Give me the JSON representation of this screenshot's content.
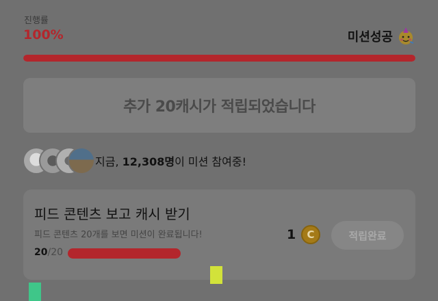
{
  "progress": {
    "label": "진행률",
    "value_text": "100%",
    "fraction": 1.0,
    "status": "미션성공",
    "status_icon": "party-face-icon"
  },
  "reward_banner": {
    "text": "추가 20캐시가 적립되었습니다"
  },
  "participants": {
    "prefix": "지금, ",
    "count": "12,308명",
    "suffix": "이 미션 참여중!"
  },
  "mission": {
    "title": "피드 콘텐츠 보고 캐시 받기",
    "description": "피드 콘텐츠 20개를 보면 미션이 완료됩니다!",
    "count_done": "20",
    "count_total": "/20",
    "reward_amount": "1",
    "coin_icon": "cash-coin-icon",
    "coin_glyph": "C",
    "button_label": "적립완료"
  },
  "colors": {
    "accent_red": "#b3262c",
    "coin_gold": "#a47a18",
    "marker_yellow": "#d2e23a",
    "marker_green": "#3fc689"
  }
}
